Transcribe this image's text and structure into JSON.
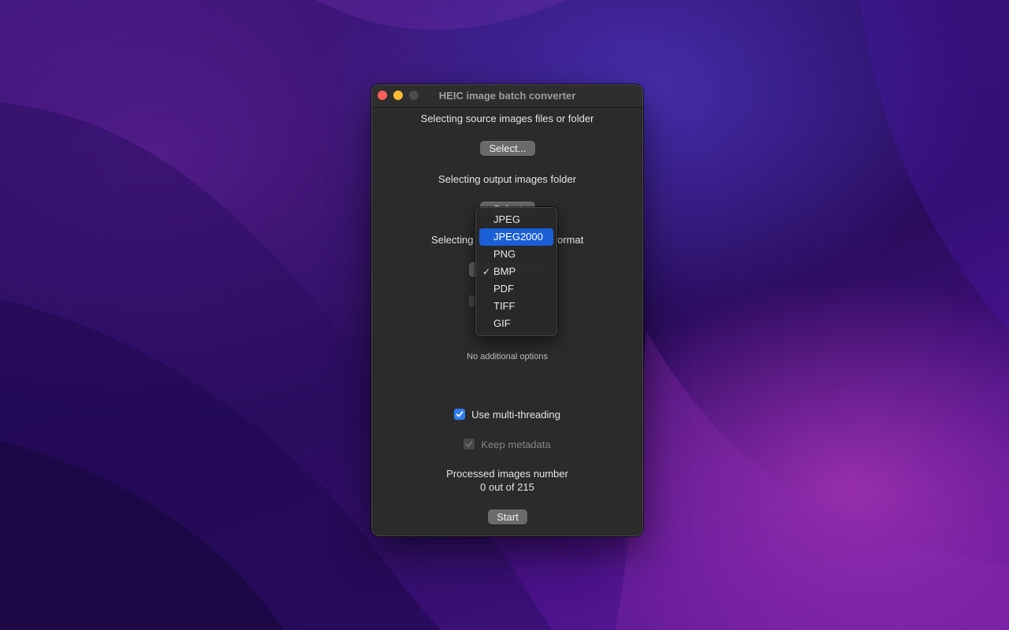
{
  "window": {
    "title": "HEIC image batch converter"
  },
  "source": {
    "label": "Selecting source images files or folder",
    "button": "Select..."
  },
  "output": {
    "label": "Selecting output images folder",
    "button_partial": "Select"
  },
  "format": {
    "label_left": "Selecting",
    "label_right": "ormat",
    "selected": "BMP"
  },
  "format_menu": {
    "items": [
      {
        "label": "JPEG",
        "checked": false,
        "highlighted": false
      },
      {
        "label": "JPEG2000",
        "checked": false,
        "highlighted": true
      },
      {
        "label": "PNG",
        "checked": false,
        "highlighted": false
      },
      {
        "label": "BMP",
        "checked": true,
        "highlighted": false
      },
      {
        "label": "PDF",
        "checked": false,
        "highlighted": false
      },
      {
        "label": "TIFF",
        "checked": false,
        "highlighted": false
      },
      {
        "label": "GIF",
        "checked": false,
        "highlighted": false
      }
    ],
    "check_glyph": "✓"
  },
  "options": {
    "note": "No additional options",
    "multithreading": {
      "label": "Use multi-threading",
      "checked": true,
      "enabled": true
    },
    "metadata": {
      "label": "Keep metadata",
      "checked": true,
      "enabled": false
    }
  },
  "progress": {
    "label": "Processed images number",
    "count_text": "0 out of 215"
  },
  "actions": {
    "start": "Start"
  },
  "colors": {
    "accent": "#2f7ef5",
    "menu_highlight": "#1a5fd6",
    "close": "#fe5f57",
    "minimize": "#febc2e"
  }
}
